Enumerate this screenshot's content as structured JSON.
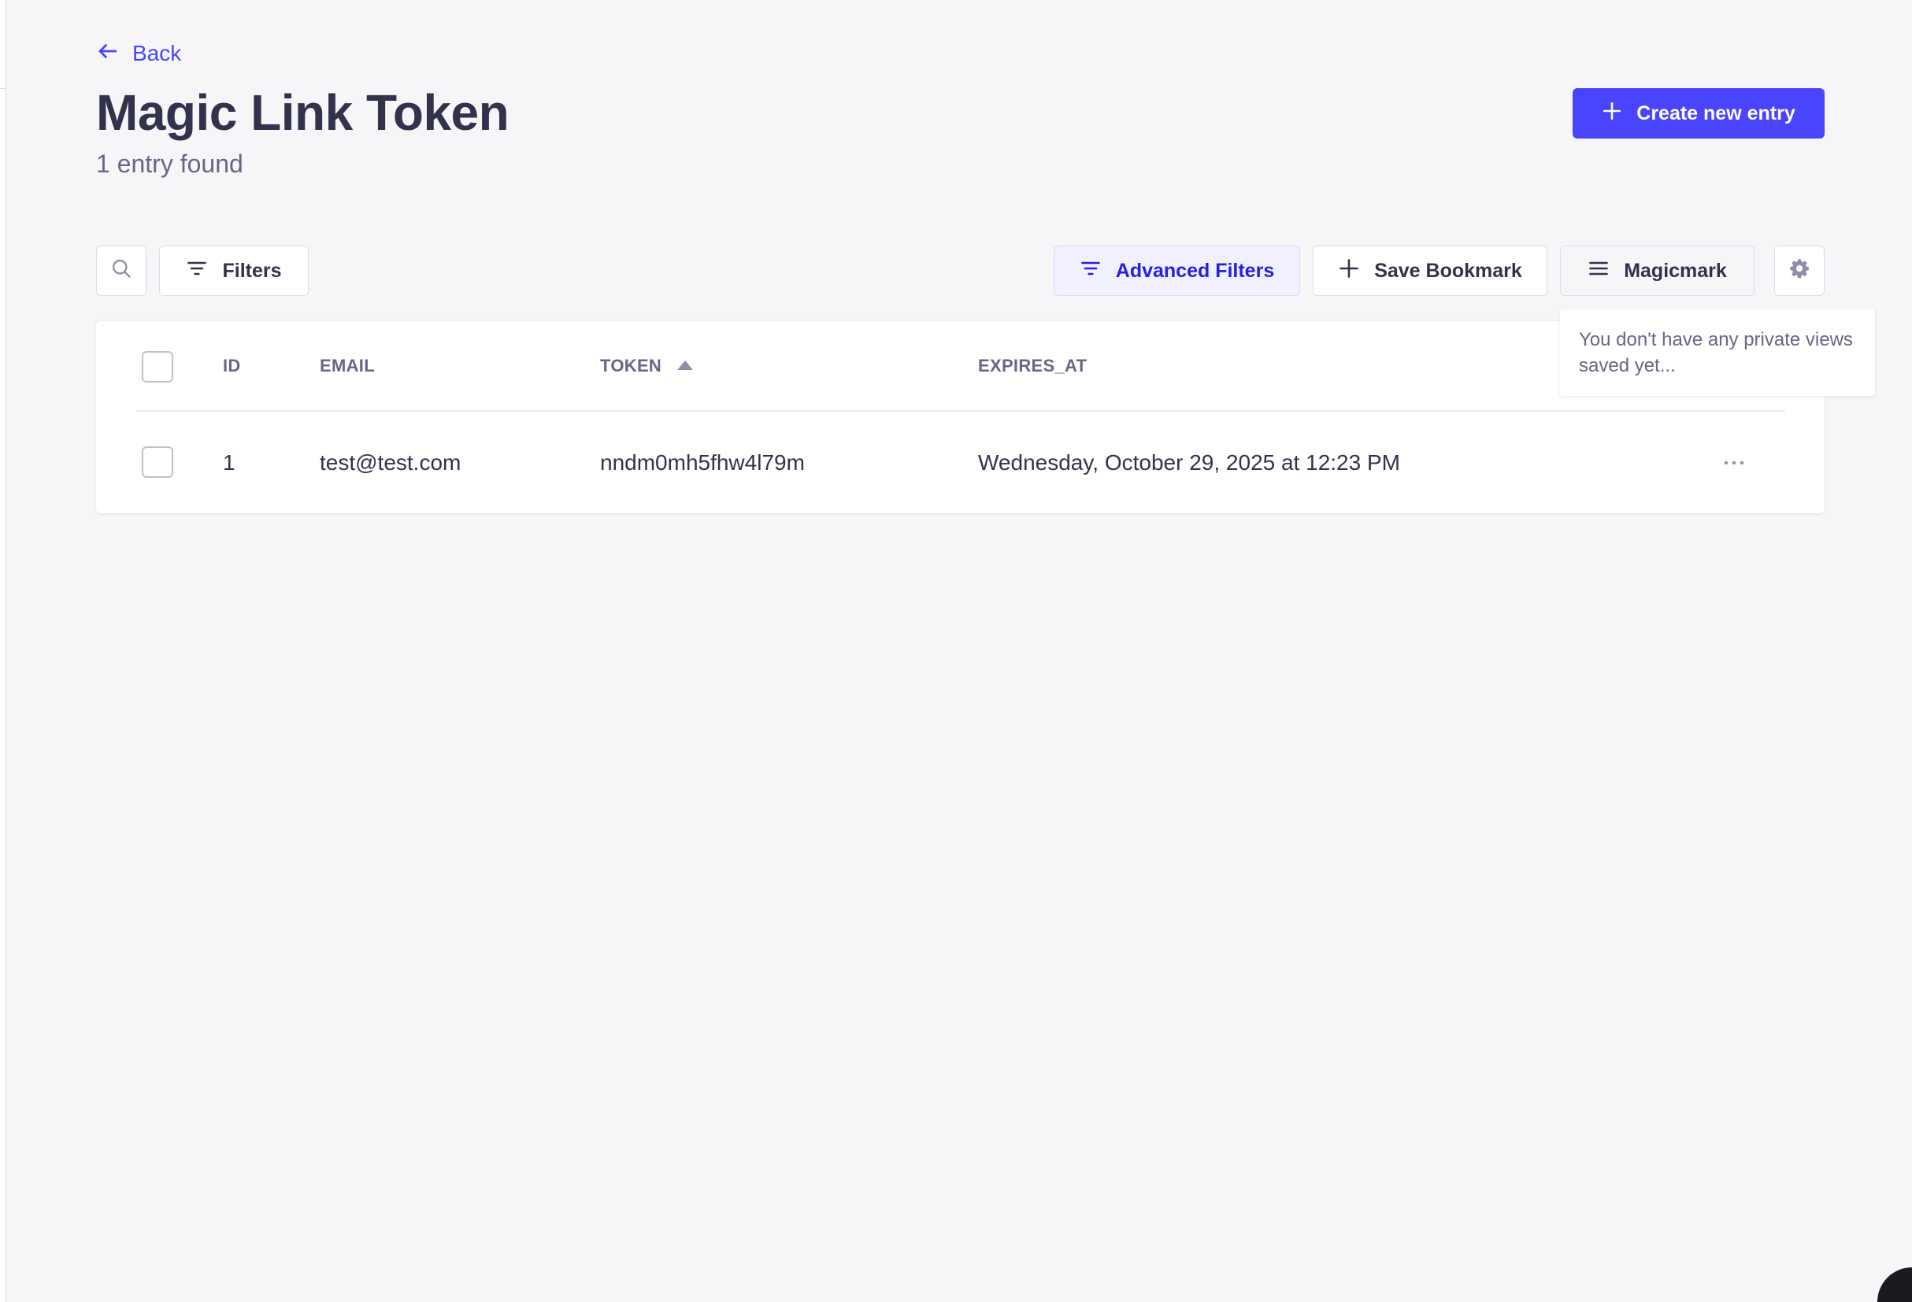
{
  "header": {
    "back_label": "Back",
    "title": "Magic Link Token",
    "subtitle": "1 entry found",
    "create_label": "Create new entry"
  },
  "toolbar": {
    "filters_label": "Filters",
    "advanced_filters_label": "Advanced Filters",
    "save_bookmark_label": "Save Bookmark",
    "magicmark_label": "Magicmark"
  },
  "tooltip": {
    "text": "You don't have any private views saved yet..."
  },
  "table": {
    "columns": [
      "ID",
      "EMAIL",
      "TOKEN",
      "EXPIRES_AT"
    ],
    "sorted_column": "TOKEN",
    "sort_direction": "ascending",
    "rows": [
      {
        "id": "1",
        "email": "test@test.com",
        "token": "nndm0mh5fhw4l79m",
        "expires_at": "Wednesday, October 29, 2025 at 12:23 PM"
      }
    ]
  },
  "colors": {
    "primary": "#4945ff",
    "text": "#32324d",
    "muted": "#666687",
    "background": "#f6f6f9"
  },
  "icons": [
    "arrow-left-icon",
    "plus-icon",
    "search-icon",
    "filter-icon",
    "hamburger-icon",
    "gear-icon",
    "sort-up-icon",
    "more-icon"
  ]
}
